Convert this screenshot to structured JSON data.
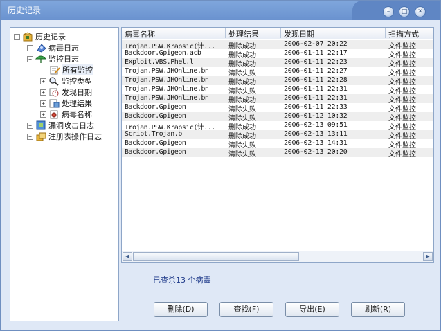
{
  "window": {
    "title": "历史记录"
  },
  "tree": {
    "root": "历史记录",
    "items": [
      {
        "label": "病毒日志"
      },
      {
        "label": "监控日志"
      },
      {
        "label": "所有监控"
      },
      {
        "label": "监控类型"
      },
      {
        "label": "发现日期"
      },
      {
        "label": "处理结果"
      },
      {
        "label": "病毒名称"
      },
      {
        "label": "漏洞攻击日志"
      },
      {
        "label": "注册表操作日志"
      }
    ]
  },
  "table": {
    "headers": [
      "病毒名称",
      "处理结果",
      "发现日期",
      "扫描方式"
    ],
    "rows": [
      [
        "Trojan.PSW.Krapsic(计...",
        "删除成功",
        "2006-02-07 20:22",
        "文件监控"
      ],
      [
        "Backdoor.Gpigeon.acb",
        "删除成功",
        "2006-01-11 22:17",
        "文件监控"
      ],
      [
        "Exploit.VBS.Phel.l",
        "删除成功",
        "2006-01-11 22:23",
        "文件监控"
      ],
      [
        "Trojan.PSW.JHOnline.bn",
        "清除失败",
        "2006-01-11 22:27",
        "文件监控"
      ],
      [
        "Trojan.PSW.JHOnline.bn",
        "删除成功",
        "2006-01-11 22:28",
        "文件监控"
      ],
      [
        "Trojan.PSW.JHOnline.bn",
        "清除失败",
        "2006-01-11 22:31",
        "文件监控"
      ],
      [
        "Trojan.PSW.JHOnline.bn",
        "删除成功",
        "2006-01-11 22:31",
        "文件监控"
      ],
      [
        "Backdoor.Gpigeon",
        "清除失败",
        "2006-01-11 22:33",
        "文件监控"
      ],
      [
        "Backdoor.Gpigeon",
        "清除失败",
        "2006-01-12 10:32",
        "文件监控"
      ],
      [
        "Trojan.PSW.Krapsic(计...",
        "删除成功",
        "2006-02-13 09:51",
        "文件监控"
      ],
      [
        "Script.Trojan.b",
        "删除成功",
        "2006-02-13 13:11",
        "文件监控"
      ],
      [
        "Backdoor.Gpigeon",
        "清除失败",
        "2006-02-13 14:31",
        "文件监控"
      ],
      [
        "Backdoor.Gpigeon",
        "清除失败",
        "2006-02-13 20:20",
        "文件监控"
      ]
    ]
  },
  "status": "已查杀13 个病毒",
  "buttons": {
    "delete": "删除(D)",
    "find": "查找(F)",
    "export": "导出(E)",
    "refresh": "刷新(R)"
  }
}
